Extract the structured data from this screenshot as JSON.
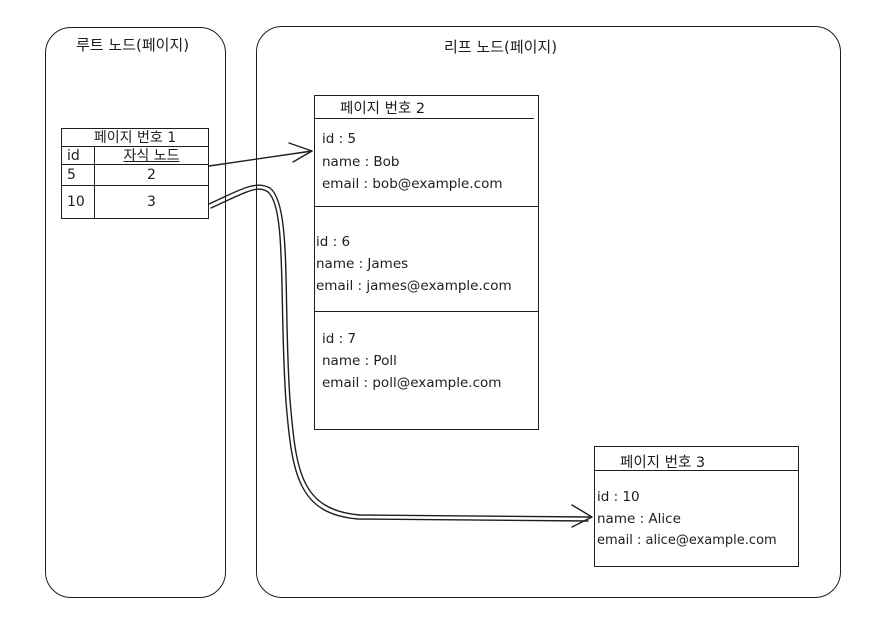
{
  "root_node": {
    "title": "루트 노드(페이지)",
    "page": {
      "title": "페이지 번호 1",
      "header": {
        "id": "id",
        "child": "자식 노드"
      },
      "rows": [
        {
          "id": "5",
          "child": "2"
        },
        {
          "id": "10",
          "child": "3"
        }
      ]
    }
  },
  "leaf_node": {
    "title": "리프 노드(페이지)",
    "pages": [
      {
        "title": "페이지 번호 2",
        "records": [
          {
            "id": "id    : 5",
            "name": "name : Bob",
            "email": "email : bob@example.com"
          },
          {
            "id": "id    : 6",
            "name": "name : James",
            "email": "email : james@example.com"
          },
          {
            "id": "id    : 7",
            "name": "name : Poll",
            "email": "email : poll@example.com"
          }
        ]
      },
      {
        "title": "페이지 번호 3",
        "records": [
          {
            "id": "id    : 10",
            "name": "name : Alice",
            "email": "email : alice@example.com"
          }
        ]
      }
    ]
  },
  "colors": {
    "stroke": "#1e1e1e",
    "background": "#ffffff"
  }
}
